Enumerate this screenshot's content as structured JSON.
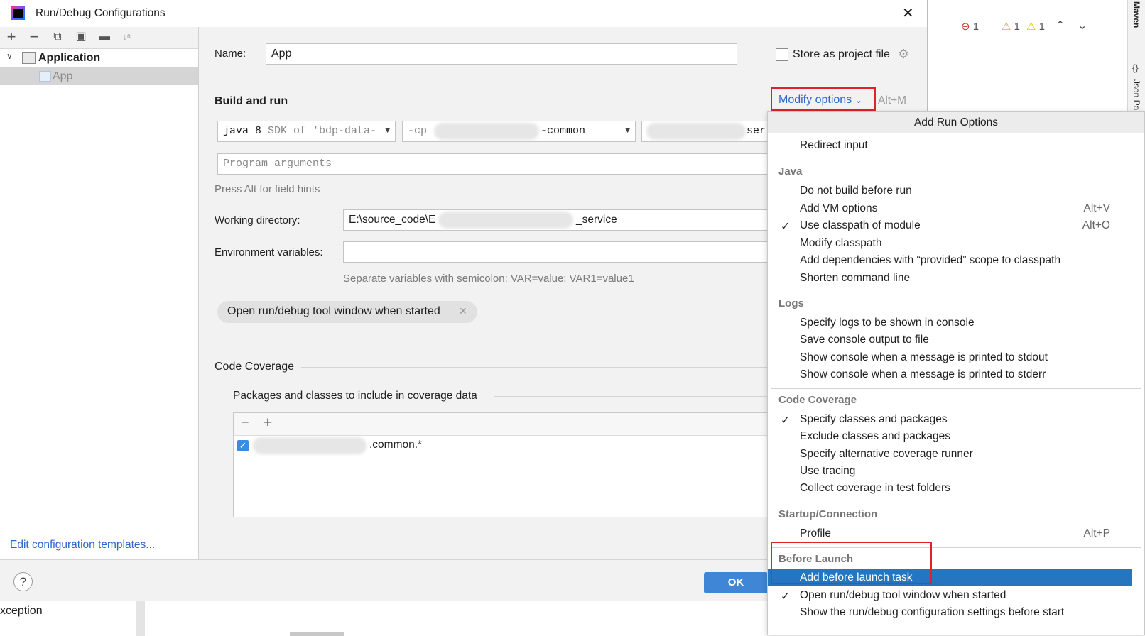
{
  "dialog": {
    "title": "Run/Debug Configurations",
    "close_glyph": "✕"
  },
  "ide": {
    "error_count": "1",
    "warning_count_1": "1",
    "warning_count_2": "1",
    "maven_label": "Maven",
    "json_label": "Json Pa",
    "bottom_text": "xception"
  },
  "tree": {
    "root_label": "Application",
    "child_label": "App",
    "edit_templates_link": "Edit configuration templates..."
  },
  "form": {
    "name_label": "Name:",
    "name_value": "App",
    "store_label": "Store as project file",
    "build_run_heading": "Build and run",
    "modify_options_label": "Modify options",
    "modify_options_shortcut": "Alt+M",
    "jdk_prefix": "java 8",
    "jdk_suffix": "SDK of 'bdp-data-",
    "cp_prefix": "-cp",
    "cp_suffix": "-common",
    "main_class_suffix": "ser",
    "program_args_placeholder": "Program arguments",
    "field_hint": "Press Alt for field hints",
    "working_dir_label": "Working directory:",
    "working_dir_prefix": "E:\\source_code\\E",
    "working_dir_suffix": "_service",
    "env_label": "Environment variables:",
    "env_hint": "Separate variables with semicolon: VAR=value; VAR1=value1",
    "chip_label": "Open run/debug tool window when started",
    "code_coverage_heading": "Code Coverage",
    "coverage_sub_label": "Packages and classes to include in coverage data",
    "coverage_entry_suffix": ".common.*",
    "coverage_entry_checked": true,
    "ok_label": "OK",
    "help_glyph": "?"
  },
  "popup": {
    "title": "Add Run Options",
    "top_item": "Redirect input",
    "sections": [
      {
        "heading": "Java",
        "items": [
          {
            "label": "Do not build before run",
            "shortcut": "",
            "checked": false
          },
          {
            "label": "Add VM options",
            "shortcut": "Alt+V",
            "checked": false
          },
          {
            "label": "Use classpath of module",
            "shortcut": "Alt+O",
            "checked": true
          },
          {
            "label": "Modify classpath",
            "shortcut": "",
            "checked": false
          },
          {
            "label": "Add dependencies with “provided” scope to classpath",
            "shortcut": "",
            "checked": false
          },
          {
            "label": "Shorten command line",
            "shortcut": "",
            "checked": false
          }
        ]
      },
      {
        "heading": "Logs",
        "items": [
          {
            "label": "Specify logs to be shown in console",
            "shortcut": "",
            "checked": false
          },
          {
            "label": "Save console output to file",
            "shortcut": "",
            "checked": false
          },
          {
            "label": "Show console when a message is printed to stdout",
            "shortcut": "",
            "checked": false
          },
          {
            "label": "Show console when a message is printed to stderr",
            "shortcut": "",
            "checked": false
          }
        ]
      },
      {
        "heading": "Code Coverage",
        "items": [
          {
            "label": "Specify classes and packages",
            "shortcut": "",
            "checked": true
          },
          {
            "label": "Exclude classes and packages",
            "shortcut": "",
            "checked": false
          },
          {
            "label": "Specify alternative coverage runner",
            "shortcut": "",
            "checked": false
          },
          {
            "label": "Use tracing",
            "shortcut": "",
            "checked": false
          },
          {
            "label": "Collect coverage in test folders",
            "shortcut": "",
            "checked": false
          }
        ]
      },
      {
        "heading": "Startup/Connection",
        "items": [
          {
            "label": "Profile",
            "shortcut": "Alt+P",
            "checked": false
          }
        ]
      },
      {
        "heading": "Before Launch",
        "items": [
          {
            "label": "Add before launch task",
            "shortcut": "",
            "checked": false,
            "selected": true
          },
          {
            "label": "Open run/debug tool window when started",
            "shortcut": "",
            "checked": true
          },
          {
            "label": "Show the run/debug configuration settings before start",
            "shortcut": "",
            "checked": false
          }
        ]
      }
    ]
  },
  "colors": {
    "accent_blue": "#2f65ca",
    "selection_blue": "#2675bf",
    "highlight_red": "#e0202a",
    "ok_button": "#3f86d6"
  }
}
